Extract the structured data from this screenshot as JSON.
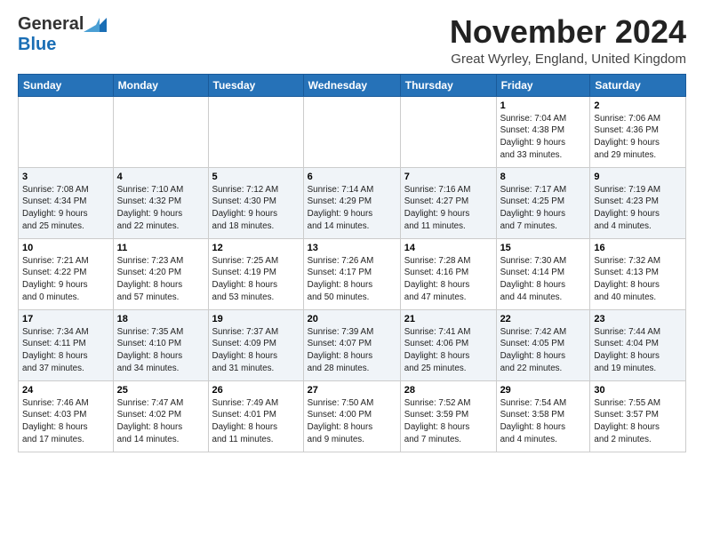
{
  "header": {
    "logo_general": "General",
    "logo_blue": "Blue",
    "month_title": "November 2024",
    "location": "Great Wyrley, England, United Kingdom"
  },
  "calendar": {
    "days_of_week": [
      "Sunday",
      "Monday",
      "Tuesday",
      "Wednesday",
      "Thursday",
      "Friday",
      "Saturday"
    ],
    "weeks": [
      [
        {
          "day": "",
          "info": ""
        },
        {
          "day": "",
          "info": ""
        },
        {
          "day": "",
          "info": ""
        },
        {
          "day": "",
          "info": ""
        },
        {
          "day": "",
          "info": ""
        },
        {
          "day": "1",
          "info": "Sunrise: 7:04 AM\nSunset: 4:38 PM\nDaylight: 9 hours\nand 33 minutes."
        },
        {
          "day": "2",
          "info": "Sunrise: 7:06 AM\nSunset: 4:36 PM\nDaylight: 9 hours\nand 29 minutes."
        }
      ],
      [
        {
          "day": "3",
          "info": "Sunrise: 7:08 AM\nSunset: 4:34 PM\nDaylight: 9 hours\nand 25 minutes."
        },
        {
          "day": "4",
          "info": "Sunrise: 7:10 AM\nSunset: 4:32 PM\nDaylight: 9 hours\nand 22 minutes."
        },
        {
          "day": "5",
          "info": "Sunrise: 7:12 AM\nSunset: 4:30 PM\nDaylight: 9 hours\nand 18 minutes."
        },
        {
          "day": "6",
          "info": "Sunrise: 7:14 AM\nSunset: 4:29 PM\nDaylight: 9 hours\nand 14 minutes."
        },
        {
          "day": "7",
          "info": "Sunrise: 7:16 AM\nSunset: 4:27 PM\nDaylight: 9 hours\nand 11 minutes."
        },
        {
          "day": "8",
          "info": "Sunrise: 7:17 AM\nSunset: 4:25 PM\nDaylight: 9 hours\nand 7 minutes."
        },
        {
          "day": "9",
          "info": "Sunrise: 7:19 AM\nSunset: 4:23 PM\nDaylight: 9 hours\nand 4 minutes."
        }
      ],
      [
        {
          "day": "10",
          "info": "Sunrise: 7:21 AM\nSunset: 4:22 PM\nDaylight: 9 hours\nand 0 minutes."
        },
        {
          "day": "11",
          "info": "Sunrise: 7:23 AM\nSunset: 4:20 PM\nDaylight: 8 hours\nand 57 minutes."
        },
        {
          "day": "12",
          "info": "Sunrise: 7:25 AM\nSunset: 4:19 PM\nDaylight: 8 hours\nand 53 minutes."
        },
        {
          "day": "13",
          "info": "Sunrise: 7:26 AM\nSunset: 4:17 PM\nDaylight: 8 hours\nand 50 minutes."
        },
        {
          "day": "14",
          "info": "Sunrise: 7:28 AM\nSunset: 4:16 PM\nDaylight: 8 hours\nand 47 minutes."
        },
        {
          "day": "15",
          "info": "Sunrise: 7:30 AM\nSunset: 4:14 PM\nDaylight: 8 hours\nand 44 minutes."
        },
        {
          "day": "16",
          "info": "Sunrise: 7:32 AM\nSunset: 4:13 PM\nDaylight: 8 hours\nand 40 minutes."
        }
      ],
      [
        {
          "day": "17",
          "info": "Sunrise: 7:34 AM\nSunset: 4:11 PM\nDaylight: 8 hours\nand 37 minutes."
        },
        {
          "day": "18",
          "info": "Sunrise: 7:35 AM\nSunset: 4:10 PM\nDaylight: 8 hours\nand 34 minutes."
        },
        {
          "day": "19",
          "info": "Sunrise: 7:37 AM\nSunset: 4:09 PM\nDaylight: 8 hours\nand 31 minutes."
        },
        {
          "day": "20",
          "info": "Sunrise: 7:39 AM\nSunset: 4:07 PM\nDaylight: 8 hours\nand 28 minutes."
        },
        {
          "day": "21",
          "info": "Sunrise: 7:41 AM\nSunset: 4:06 PM\nDaylight: 8 hours\nand 25 minutes."
        },
        {
          "day": "22",
          "info": "Sunrise: 7:42 AM\nSunset: 4:05 PM\nDaylight: 8 hours\nand 22 minutes."
        },
        {
          "day": "23",
          "info": "Sunrise: 7:44 AM\nSunset: 4:04 PM\nDaylight: 8 hours\nand 19 minutes."
        }
      ],
      [
        {
          "day": "24",
          "info": "Sunrise: 7:46 AM\nSunset: 4:03 PM\nDaylight: 8 hours\nand 17 minutes."
        },
        {
          "day": "25",
          "info": "Sunrise: 7:47 AM\nSunset: 4:02 PM\nDaylight: 8 hours\nand 14 minutes."
        },
        {
          "day": "26",
          "info": "Sunrise: 7:49 AM\nSunset: 4:01 PM\nDaylight: 8 hours\nand 11 minutes."
        },
        {
          "day": "27",
          "info": "Sunrise: 7:50 AM\nSunset: 4:00 PM\nDaylight: 8 hours\nand 9 minutes."
        },
        {
          "day": "28",
          "info": "Sunrise: 7:52 AM\nSunset: 3:59 PM\nDaylight: 8 hours\nand 7 minutes."
        },
        {
          "day": "29",
          "info": "Sunrise: 7:54 AM\nSunset: 3:58 PM\nDaylight: 8 hours\nand 4 minutes."
        },
        {
          "day": "30",
          "info": "Sunrise: 7:55 AM\nSunset: 3:57 PM\nDaylight: 8 hours\nand 2 minutes."
        }
      ]
    ]
  }
}
